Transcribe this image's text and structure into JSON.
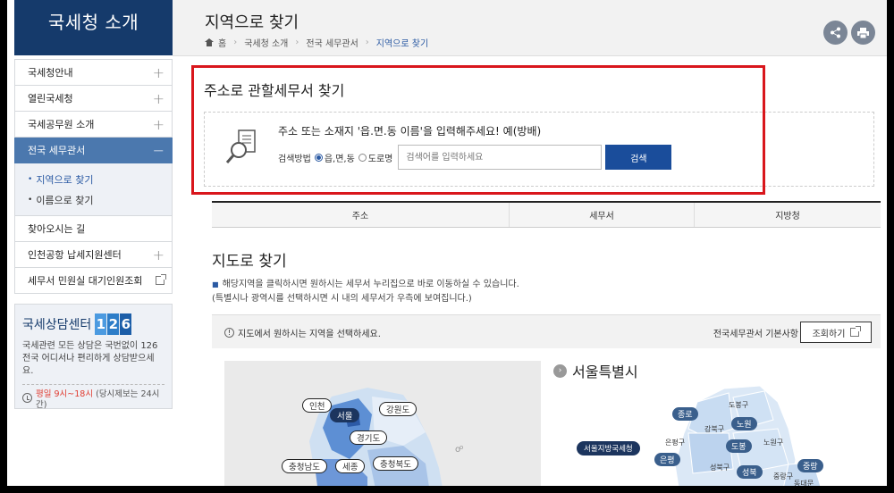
{
  "sidebar": {
    "title": "국세청 소개",
    "items": [
      {
        "label": "국세청안내",
        "icon": "plus-icon"
      },
      {
        "label": "열린국세청",
        "icon": "plus-icon"
      },
      {
        "label": "국세공무원 소개",
        "icon": "plus-icon"
      },
      {
        "label": "전국 세무관서",
        "icon": "minus-icon"
      }
    ],
    "sub": [
      "지역으로 찾기",
      "이름으로 찾기"
    ],
    "items2": [
      {
        "label": "찾아오시는 길"
      },
      {
        "label": "인천공항 납세지원센터",
        "icon": "plus-icon"
      },
      {
        "label": "세무서 민원실 대기인원조회",
        "icon": "external-link-icon"
      }
    ],
    "consult": {
      "title": "국세상담센터",
      "number": [
        "1",
        "2",
        "6"
      ],
      "desc": "국세관련 모든 상담은 국번없이 126 전국 어디서나 편리하게 상담받으세요.",
      "time_red": "평일 9시~18시",
      "time_rest": "(당시제보는 24시간)"
    }
  },
  "header": {
    "title": "지역으로 찾기",
    "breadcrumb": [
      "홈",
      "국세청 소개",
      "전국 세무관서",
      "지역으로 찾기"
    ]
  },
  "search": {
    "title": "주소로 관할세무서 찾기",
    "guide": "주소 또는 소재지 '읍.면.동 이름'을 입력해주세요! 예(방배)",
    "method_label": "검색방법",
    "option1": "읍,면,동",
    "option2": "도로명",
    "placeholder": "검색어를 입력하세요",
    "button": "검색"
  },
  "tabs": [
    "주소",
    "세무서",
    "지방청"
  ],
  "map_section": {
    "title": "지도로 찾기",
    "desc1": "해당지역을 클릭하시면 원하시는 세무서 누리집으로 바로 이동하실 수 있습니다.",
    "desc2": "(특별시나 광역시를 선택하시면 시 내의 세무서가 우측에 보여집니다.)",
    "info": "지도에서 원하시는 지역을 선택하세요.",
    "basic": "전국세무관서 기본사항",
    "view_button": "조회하기",
    "regions": [
      "인천",
      "서울",
      "강원도",
      "경기도",
      "충청남도",
      "세종",
      "충청북도"
    ],
    "seoul_title": "서울특별시",
    "seoul_office": "서울지방국세청",
    "districts": [
      "종로",
      "노원",
      "도봉",
      "은평",
      "성북",
      "중랑"
    ],
    "district_names": [
      "도봉구",
      "강북구",
      "노원구",
      "은평구",
      "성북구",
      "중랑구",
      "동대문"
    ]
  },
  "colors": {
    "brand": "#153a6b",
    "accent": "#1a4d9b",
    "highlight": "#d9161c"
  }
}
